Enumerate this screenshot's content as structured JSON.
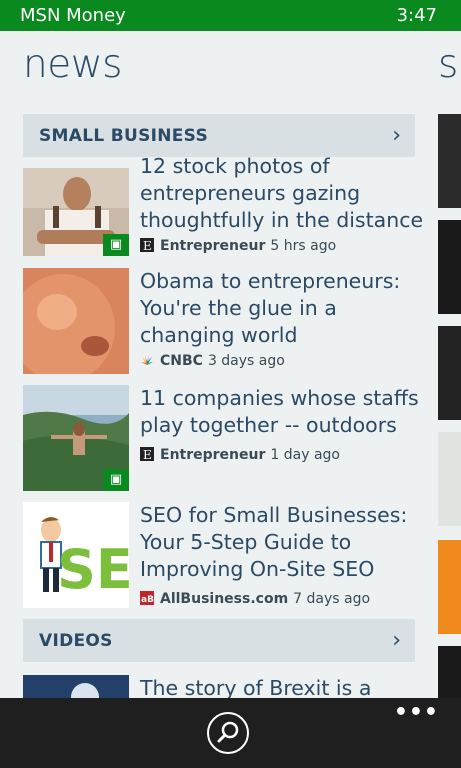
{
  "status_bar": {
    "app_name": "MSN Money",
    "time": "3:47"
  },
  "panorama": {
    "title": "news",
    "next_title_fragment": "sc"
  },
  "sections": [
    {
      "label": "SMALL BUSINESS"
    },
    {
      "label": "VIDEOS"
    }
  ],
  "articles": [
    {
      "headline": "12 stock photos of entrepreneurs gazing thoughtfully in the distance",
      "source": "Entrepreneur",
      "age": "5 hrs ago",
      "source_icon": "entrepreneur-e-icon",
      "has_photo_badge": true
    },
    {
      "headline": "Obama to entrepreneurs: You're the glue in a changing world",
      "source": "CNBC",
      "age": "3 days ago",
      "source_icon": "cnbc-peacock-icon",
      "has_photo_badge": false
    },
    {
      "headline": "11 companies whose staffs play together -- outdoors",
      "source": "Entrepreneur",
      "age": "1 day ago",
      "source_icon": "entrepreneur-e-icon",
      "has_photo_badge": true
    },
    {
      "headline": "SEO for Small Businesses: Your 5-Step Guide to Improving On-Site SEO",
      "source": "AllBusiness.com",
      "age": "7 days ago",
      "source_icon": "allbusiness-ab-icon",
      "has_photo_badge": false
    },
    {
      "headline": "The story of Brexit is a story",
      "source": "",
      "age": "",
      "has_photo_badge": false
    }
  ],
  "thumb_text": {
    "seo": "SE"
  },
  "app_bar": {
    "search_icon": "search-icon",
    "more_icon": "ellipsis-icon"
  },
  "colors": {
    "status_green": "#0a8a1e",
    "text_navy": "#2a4a66",
    "header_bg": "#d9e0e3",
    "app_bar": "#1f1f1f"
  }
}
